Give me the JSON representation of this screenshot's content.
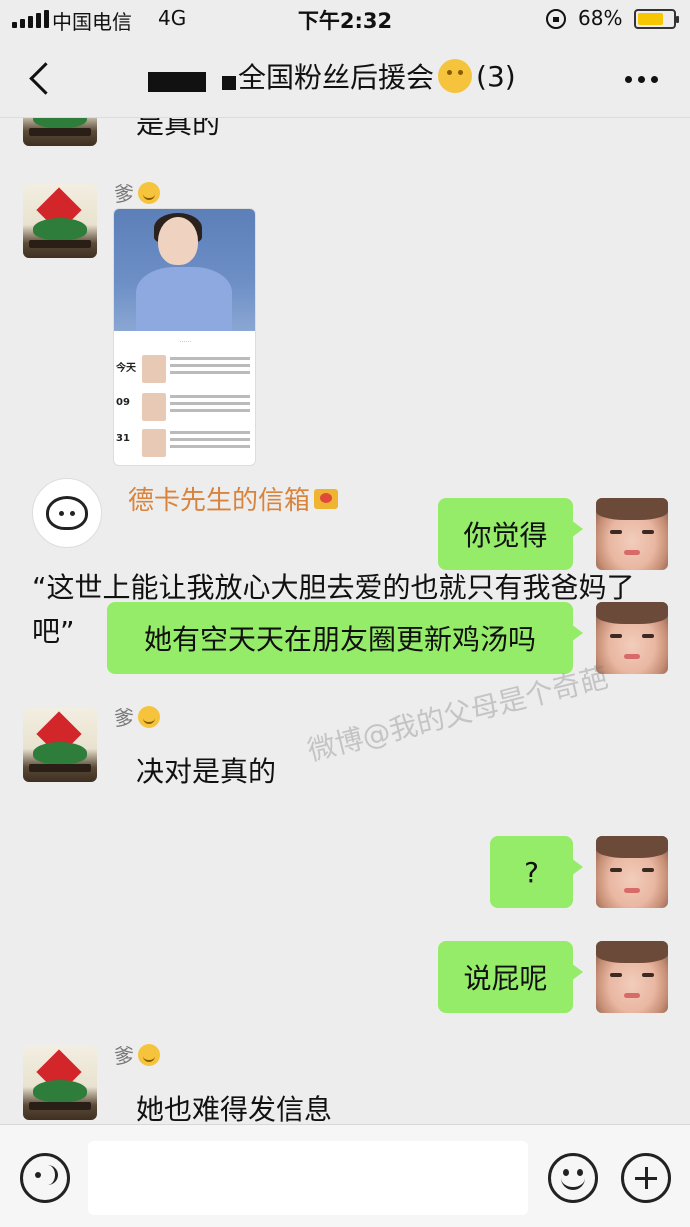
{
  "status_bar": {
    "carrier": "中国电信",
    "network": "4G",
    "time": "下午2:32",
    "battery": "68%"
  },
  "nav": {
    "title": "全国粉丝后援会",
    "member_count": "(3)"
  },
  "chat": {
    "partial_top_text": "是真的",
    "sender_name": "爹",
    "forwarded": {
      "source": "德卡先生的信箱",
      "quote": "“这世上能让我放心大胆去爱的也就只有我爸妈了吧”"
    },
    "shot": {
      "rows": [
        "今天",
        "09",
        "31"
      ]
    },
    "messages": [
      {
        "side": "right",
        "text": "你觉得"
      },
      {
        "side": "right",
        "text": "她有空天天在朋友圈更新鸡汤吗"
      },
      {
        "side": "left",
        "text": "决对是真的"
      },
      {
        "side": "right",
        "text": "?"
      },
      {
        "side": "right",
        "text": "说屁呢"
      },
      {
        "side": "left",
        "text": "她也难得发信息"
      }
    ],
    "watermark": "微博@我的父母是个奇葩"
  },
  "input": {
    "value": ""
  },
  "icons": {
    "back": "chevron-left-icon",
    "more": "more-dots-icon",
    "voice": "voice-icon",
    "emoji": "emoji-icon",
    "plus": "plus-icon"
  },
  "colors": {
    "bubble_green": "#95ec69",
    "background": "#ededed",
    "card_name": "#d9843d"
  }
}
